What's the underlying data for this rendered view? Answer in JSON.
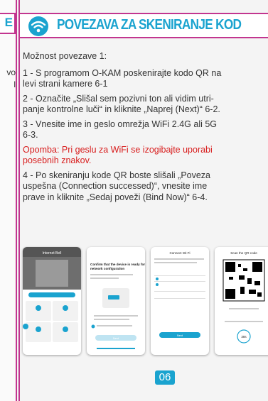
{
  "left_fragment": {
    "header_letter": "E",
    "text_lines": [
      "vo",
      "l"
    ]
  },
  "header": {
    "title": "POVEZAVA ZA SKENIRANJE KOD",
    "icon": "wifi-icon",
    "accent_color": "#1aa3cf",
    "border_color": "#c2358f"
  },
  "content": {
    "intro": "Možnost povezave 1:",
    "step1": "1 - S programom O-KAM poskenirajte kodo QR na\nlevi strani kamere 6-1",
    "step2": "2 - Označite „Slišal sem pozivni ton ali vidim utri-\npanje kontrolne luči“ in kliknite „Naprej (Next)“ 6-2.",
    "step3": "3 - Vnesite ime in geslo omrežja WiFi 2.4G ali 5G\n6-3.",
    "note": "Opomba: Pri geslu za WiFi se izogibajte uporabi\nposebnih znakov.",
    "note_color": "#d81d1d",
    "step4": "4 - Po skeniranju kode QR boste slišali „Poveza\nuspešna (Connection successed)“, vnesite ime\nprave in kliknite „Sedaj poveži (Bind Now)“ 6-4."
  },
  "screens": {
    "s1": {
      "title": "Internet Bell"
    },
    "s2": {
      "heading": "Confirm that the device is ready for network configuration",
      "next": "Next"
    },
    "s3": {
      "title": "Connect Wi-Fi",
      "next": "Next"
    },
    "s4": {
      "title": "Scan the QR code",
      "timer": "38s"
    }
  },
  "footer": {
    "page_number": "06"
  }
}
